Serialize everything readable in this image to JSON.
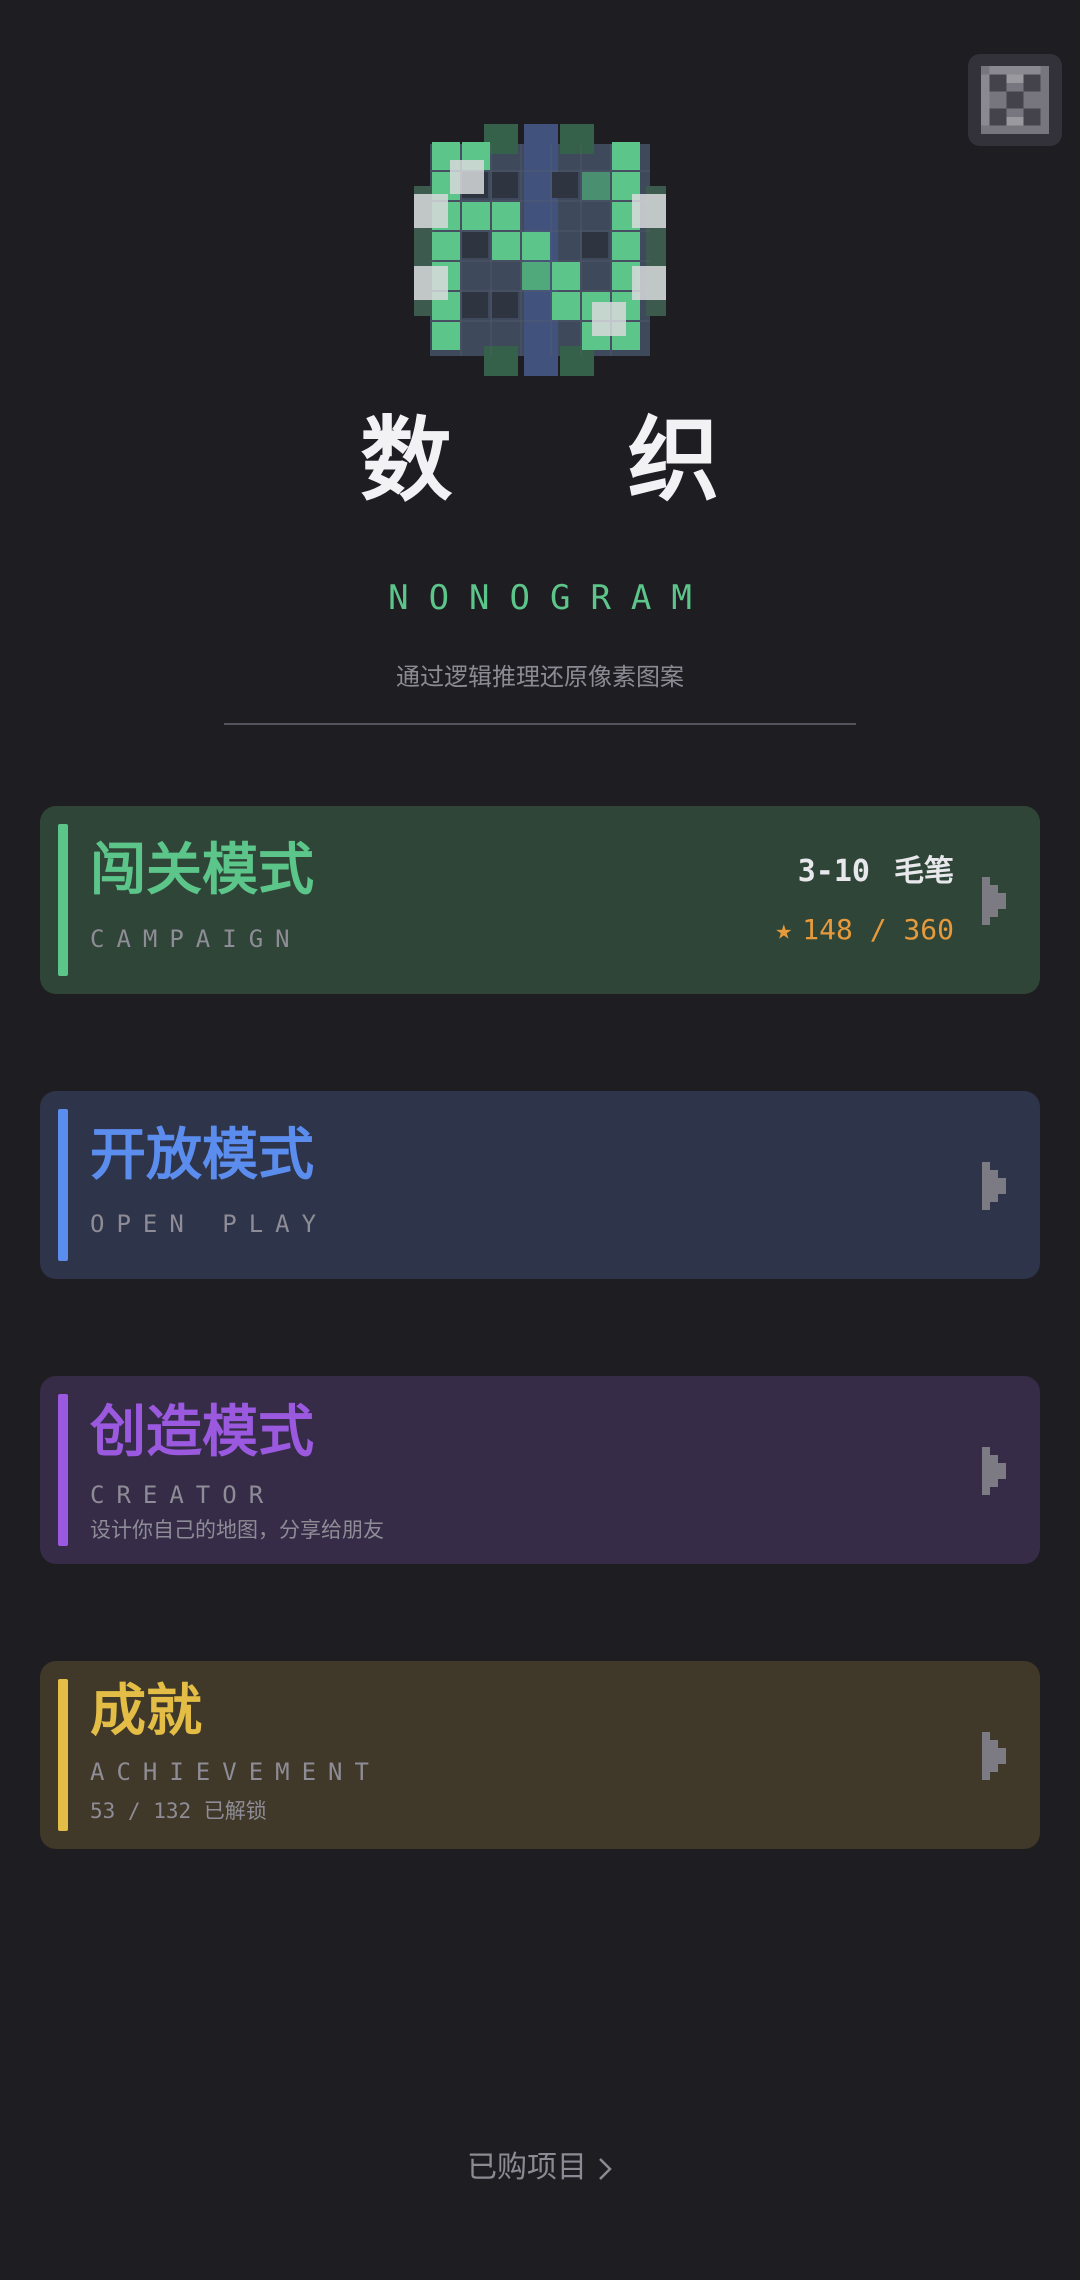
{
  "app": {
    "title": "数 织",
    "subtitle": "NONOGRAM",
    "tagline": "通过逻辑推理还原像素图案"
  },
  "header": {
    "close_icon": "close-icon"
  },
  "modes": [
    {
      "name": "闯关模式",
      "english": "CAMPAIGN",
      "level": "3-10",
      "level_name": "毛笔",
      "stars_text": "148 / 360",
      "star_icon": "star-icon",
      "color": "#5cc58a"
    },
    {
      "name": "开放模式",
      "english": "OPEN PLAY",
      "color": "#5b8def"
    },
    {
      "name": "创造模式",
      "english": "CREATOR",
      "description": "设计你自己的地图，分享给朋友",
      "color": "#9b59e0"
    },
    {
      "name": "成就",
      "english": "ACHIEVEMENT",
      "description": "53 / 132 已解锁",
      "color": "#e3bd45"
    }
  ],
  "footer": {
    "purchased_label": "已购项目"
  }
}
